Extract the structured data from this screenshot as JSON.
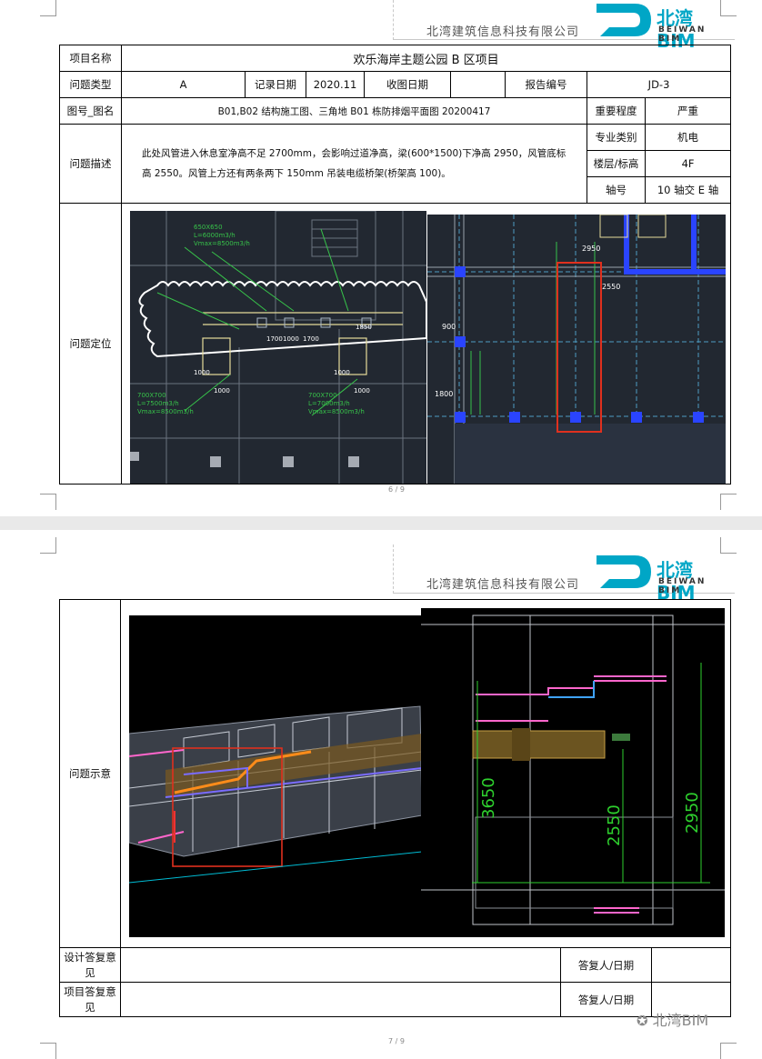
{
  "company": "北湾建筑信息科技有限公司",
  "logo": {
    "main": "北湾BIM",
    "sub": "BEIWAN BIM"
  },
  "page1": {
    "page_number": "6 / 9",
    "project_name_label": "项目名称",
    "project_name": "欢乐海岸主题公园 B 区项目",
    "issue_type_label": "问题类型",
    "issue_type": "A",
    "record_date_label": "记录日期",
    "record_date": "2020.11",
    "receive_date_label": "收图日期",
    "receive_date": "",
    "report_no_label": "报告编号",
    "report_no": "JD-3",
    "drawing_label": "图号_图名",
    "drawing": "B01,B02 结构施工图、三角地 B01 栋防排烟平面图 20200417",
    "severity_label": "重要程度",
    "severity": "严重",
    "description_label": "问题描述",
    "description": "此处风管进入休息室净高不足 2700mm，会影响过道净高，梁(600*1500)下净高 2950，风管底标高 2550。风管上方还有两条两下 150mm 吊装电缆桥架(桥架高 100)。",
    "discipline_label": "专业类别",
    "discipline": "机电",
    "floor_label": "楼层/标高",
    "floor": "4F",
    "axis_label": "轴号",
    "axis": "10 轴交 E 轴",
    "location_label": "问题定位",
    "cad_left_labels": [
      "1700",
      "1000",
      "1700",
      "1850",
      "1000",
      "1000",
      "1000",
      "1000"
    ],
    "cad_right_labels": [
      "2550",
      "2950",
      "900",
      "1800"
    ]
  },
  "page2": {
    "page_number": "7 / 9",
    "illustration_label": "问题示意",
    "dims": [
      "3650",
      "2550",
      "2950"
    ],
    "design_reply_label": "设计答复意见",
    "project_reply_label": "项目答复意见",
    "replier_label": "答复人/日期",
    "design_reply": "",
    "project_reply": "",
    "design_replier": "",
    "project_replier": ""
  },
  "watermark": "北湾BIM"
}
